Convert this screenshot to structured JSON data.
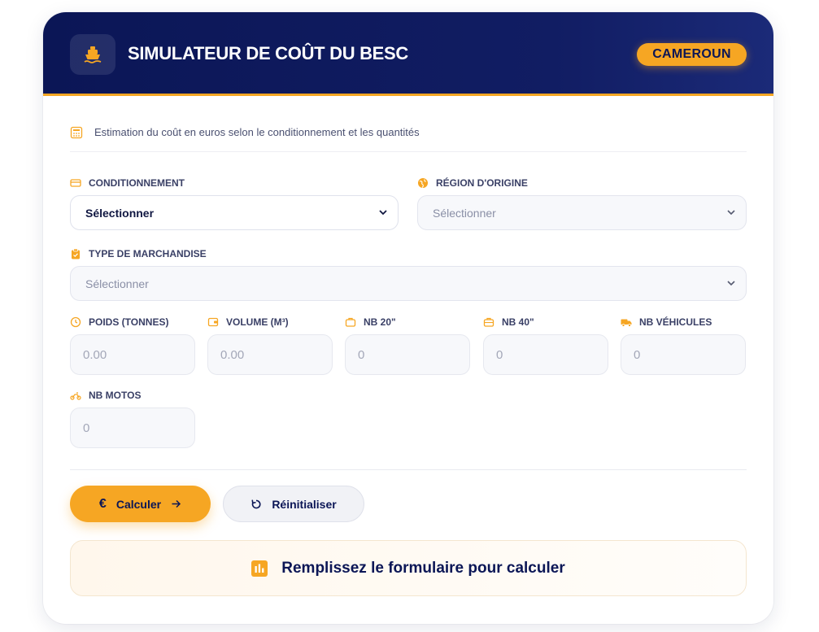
{
  "header": {
    "title": "SIMULATEUR DE COÛT DU BESC",
    "country_badge": "CAMEROUN",
    "logo_icon": "ship-icon"
  },
  "subtitle": "Estimation du coût en euros selon le conditionnement et les quantités",
  "fields": {
    "conditionnement": {
      "label": "CONDITIONNEMENT",
      "value": "Sélectionner"
    },
    "region": {
      "label": "RÉGION D'ORIGINE",
      "placeholder": "Sélectionner"
    },
    "type_marchandise": {
      "label": "TYPE DE MARCHANDISE",
      "placeholder": "Sélectionner"
    },
    "poids": {
      "label": "POIDS (TONNES)",
      "placeholder": "0.00"
    },
    "volume": {
      "label": "VOLUME (M³)",
      "placeholder": "0.00"
    },
    "nb20": {
      "label": "NB 20\"",
      "placeholder": "0"
    },
    "nb40": {
      "label": "NB 40\"",
      "placeholder": "0"
    },
    "nb_vehicules": {
      "label": "NB VÉHICULES",
      "placeholder": "0"
    },
    "nb_motos": {
      "label": "NB MOTOS",
      "placeholder": "0"
    }
  },
  "buttons": {
    "calculate": "Calculer",
    "reset": "Réinitialiser"
  },
  "result_message": "Remplissez le formulaire pour calculer",
  "colors": {
    "header_bg": "#0b1656",
    "accent": "#f6a623",
    "text_dark": "#0b1656"
  }
}
